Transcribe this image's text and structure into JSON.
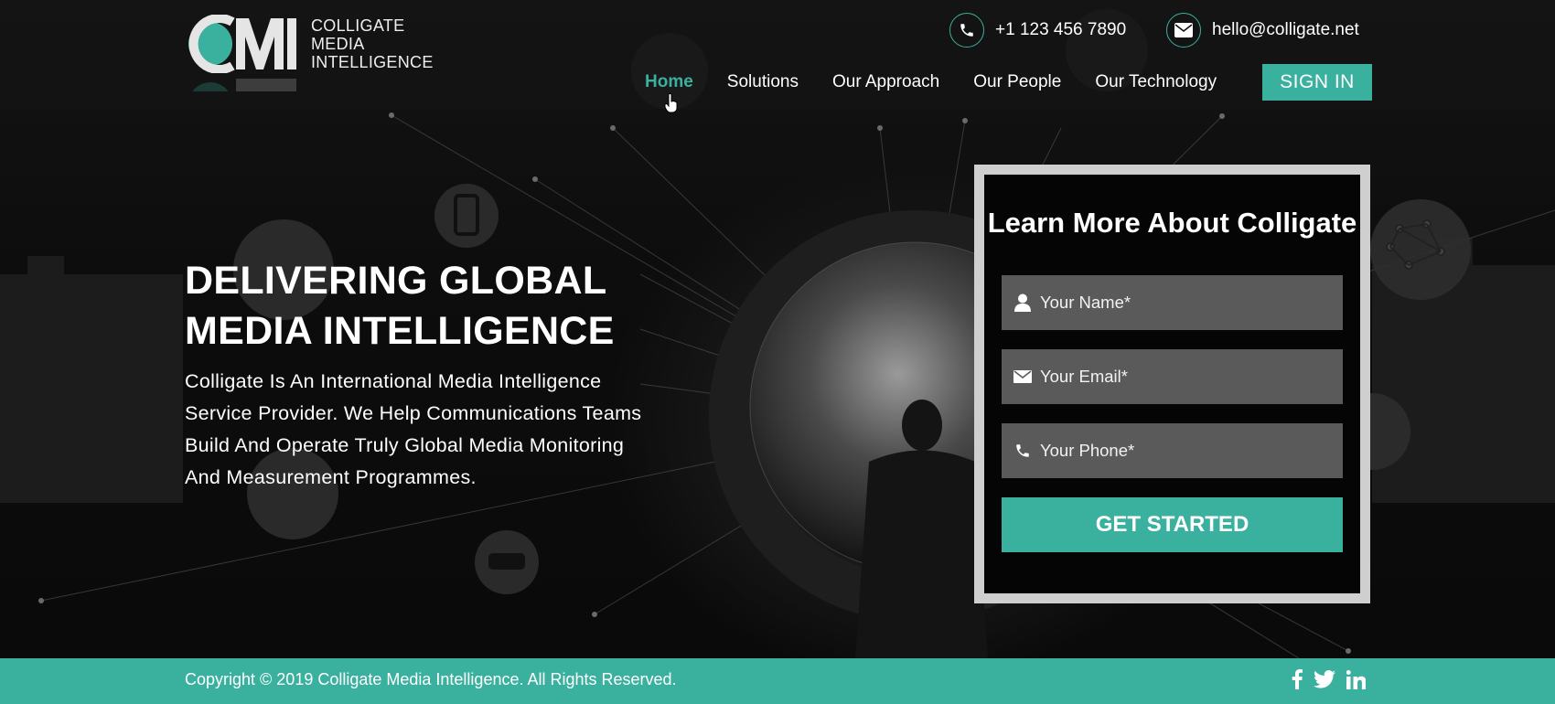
{
  "header": {
    "logo": {
      "mark": "CMI",
      "line1": "COLLIGATE",
      "line2": "MEDIA",
      "line3": "INTELLIGENCE"
    },
    "phone": "+1 123 456 7890",
    "email": "hello@colligate.net",
    "nav": [
      "Home",
      "Solutions",
      "Our Approach",
      "Our People",
      "Our Technology"
    ],
    "active_nav": "Home",
    "sign_in": "SIGN IN"
  },
  "hero": {
    "title_line1": "DELIVERING GLOBAL",
    "title_line2": "MEDIA INTELLIGENCE",
    "description": "Colligate Is An International Media Intelligence Service Provider. We Help Communications Teams Build And Operate Truly Global Media Monitoring And Measurement Programmes."
  },
  "form": {
    "title": "Learn More About Colligate",
    "name_placeholder": "Your Name*",
    "email_placeholder": "Your Email*",
    "phone_placeholder": "Your Phone*",
    "submit": "GET STARTED"
  },
  "footer": {
    "copyright": "Copyright © 2019 Colligate Media Intelligence. All Rights Reserved.",
    "social": [
      "facebook-icon",
      "twitter-icon",
      "linkedin-icon"
    ]
  },
  "colors": {
    "accent": "#3ab09e",
    "background": "#0b0b0b",
    "field": "#5a5a5a",
    "frame": "#cfcfcf"
  }
}
